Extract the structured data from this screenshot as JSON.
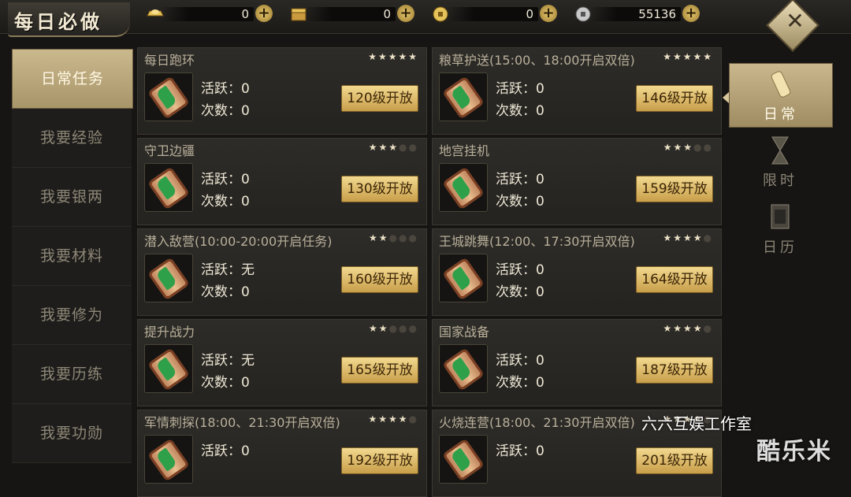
{
  "header": {
    "title": "每日必做",
    "currencies": [
      {
        "icon": "gold-ingot-icon",
        "value": "0"
      },
      {
        "icon": "treasure-box-icon",
        "value": "0"
      },
      {
        "icon": "coin-icon",
        "value": "0"
      },
      {
        "icon": "silver-coin-icon",
        "value": "55136"
      }
    ],
    "plus": "+"
  },
  "left_menu": [
    {
      "label": "日常任务",
      "active": true
    },
    {
      "label": "我要经验"
    },
    {
      "label": "我要银两"
    },
    {
      "label": "我要材料"
    },
    {
      "label": "我要修为"
    },
    {
      "label": "我要历练"
    },
    {
      "label": "我要功勋"
    }
  ],
  "activity_label": "活跃：",
  "count_label": "次数：",
  "tasks": [
    {
      "title": "每日跑环",
      "stars": 5,
      "activity": "0",
      "count": "0",
      "level": "120级开放"
    },
    {
      "title": "粮草护送(15:00、18:00开启双倍)",
      "stars": 5,
      "activity": "0",
      "count": "0",
      "level": "146级开放"
    },
    {
      "title": "守卫边疆",
      "stars": 3,
      "activity": "0",
      "count": "0",
      "level": "130级开放"
    },
    {
      "title": "地宫挂机",
      "stars": 3,
      "activity": "0",
      "count": "0",
      "level": "159级开放"
    },
    {
      "title": "潜入敌营(10:00-20:00开启任务)",
      "stars": 2,
      "activity": "无",
      "count": "0",
      "level": "160级开放"
    },
    {
      "title": "王城跳舞(12:00、17:30开启双倍)",
      "stars": 4,
      "activity": "0",
      "count": "0",
      "level": "164级开放"
    },
    {
      "title": "提升战力",
      "stars": 2,
      "activity": "无",
      "count": "0",
      "level": "165级开放"
    },
    {
      "title": "国家战备",
      "stars": 4,
      "activity": "0",
      "count": "0",
      "level": "187级开放"
    },
    {
      "title": "军情刺探(18:00、21:30开启双倍)",
      "stars": 4,
      "activity": "0",
      "count": "",
      "level": "192级开放"
    },
    {
      "title": "火烧连营(18:00、21:30开启双倍)",
      "stars": 4,
      "activity": "0",
      "count": "",
      "level": "201级开放"
    }
  ],
  "right_tabs": [
    {
      "label": "日常",
      "icon": "scroll-icon",
      "active": true
    },
    {
      "label": "限时",
      "icon": "hourglass-icon"
    },
    {
      "label": "日历",
      "icon": "calendar-icon"
    }
  ],
  "watermark": {
    "text": "六六互娱工作室",
    "logo": "酷乐米"
  }
}
